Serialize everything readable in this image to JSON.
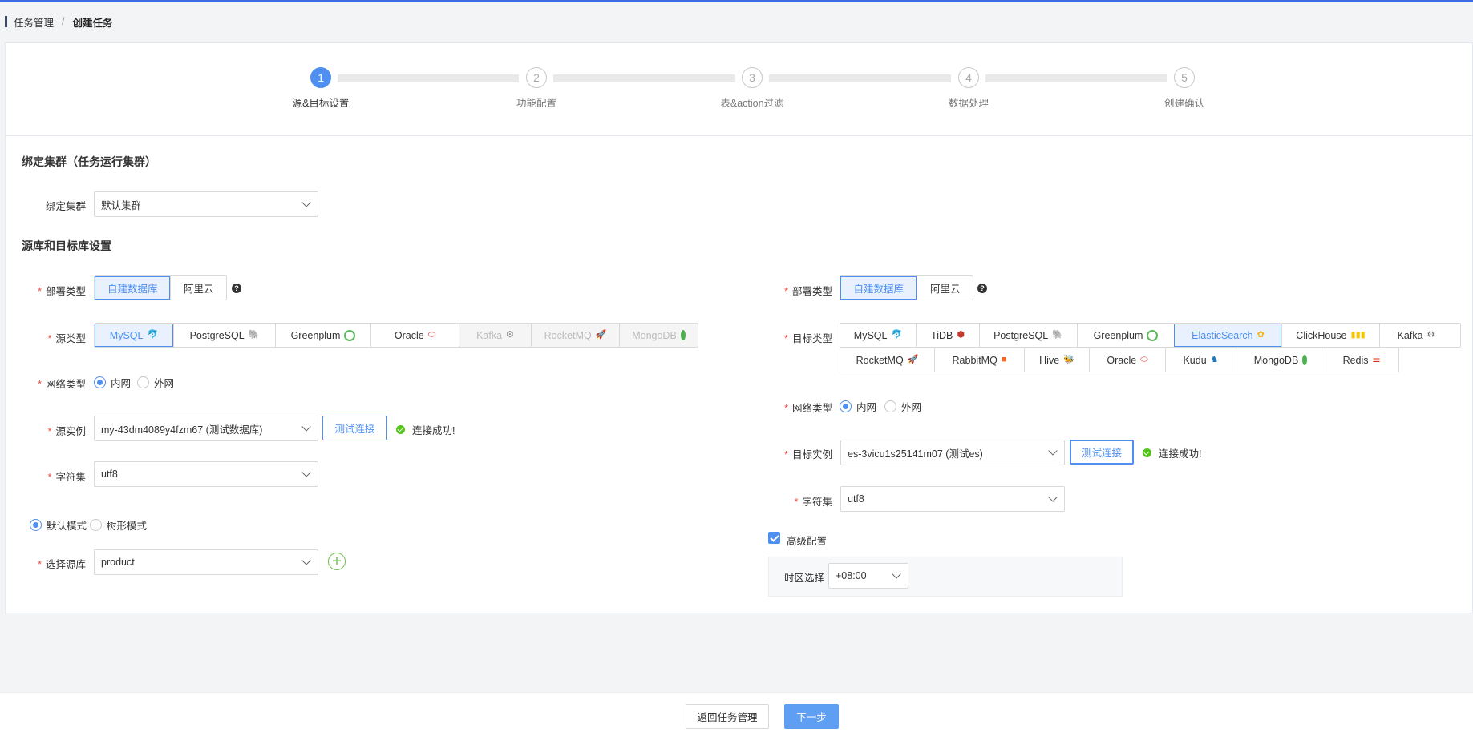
{
  "breadcrumb": {
    "parent": "任务管理",
    "separator": "/",
    "current": "创建任务"
  },
  "steps": [
    {
      "num": "1",
      "label": "源&目标设置",
      "active": true
    },
    {
      "num": "2",
      "label": "功能配置",
      "active": false
    },
    {
      "num": "3",
      "label": "表&action过滤",
      "active": false
    },
    {
      "num": "4",
      "label": "数据处理",
      "active": false
    },
    {
      "num": "5",
      "label": "创建确认",
      "active": false
    }
  ],
  "cluster_section": {
    "title": "绑定集群（任务运行集群）",
    "label": "绑定集群",
    "value": "默认集群"
  },
  "db_section": {
    "title": "源库和目标库设置"
  },
  "source": {
    "deploy_label": "部署类型",
    "deploy_options": [
      "自建数据库",
      "阿里云"
    ],
    "type_label": "源类型",
    "types": [
      "MySQL",
      "PostgreSQL",
      "Greenplum",
      "Oracle",
      "Kafka",
      "RocketMQ",
      "MongoDB"
    ],
    "network_label": "网络类型",
    "network_options": [
      "内网",
      "外网"
    ],
    "instance_label": "源实例",
    "instance_value": "my-43dm4089y4fzm67 (测试数据库)",
    "test_button": "测试连接",
    "connect_status": "连接成功!",
    "charset_label": "字符集",
    "charset_value": "utf8",
    "mode_options": [
      "默认模式",
      "树形模式"
    ],
    "db_label": "选择源库",
    "db_value": "product",
    "add_symbol": "+"
  },
  "target": {
    "deploy_label": "部署类型",
    "deploy_options": [
      "自建数据库",
      "阿里云"
    ],
    "type_label": "目标类型",
    "types_row1": [
      "MySQL",
      "TiDB",
      "PostgreSQL",
      "Greenplum",
      "ElasticSearch",
      "ClickHouse",
      "Kafka"
    ],
    "types_row2": [
      "RocketMQ",
      "RabbitMQ",
      "Hive",
      "Oracle",
      "Kudu",
      "MongoDB",
      "Redis"
    ],
    "network_label": "网络类型",
    "network_options": [
      "内网",
      "外网"
    ],
    "instance_label": "目标实例",
    "instance_value": "es-3vicu1s25141m07 (测试es)",
    "test_button": "测试连接",
    "connect_status": "连接成功!",
    "charset_label": "字符集",
    "charset_value": "utf8",
    "advanced_label": "高级配置",
    "timezone_label": "时区选择",
    "timezone_value": "+08:00"
  },
  "help_symbol": "?",
  "required_mark": "*",
  "footer": {
    "back_button": "返回任务管理",
    "next_button": "下一步"
  },
  "colors": {
    "accent": "#4e8ff0",
    "success": "#52c41a",
    "required": "#e74c3c"
  }
}
